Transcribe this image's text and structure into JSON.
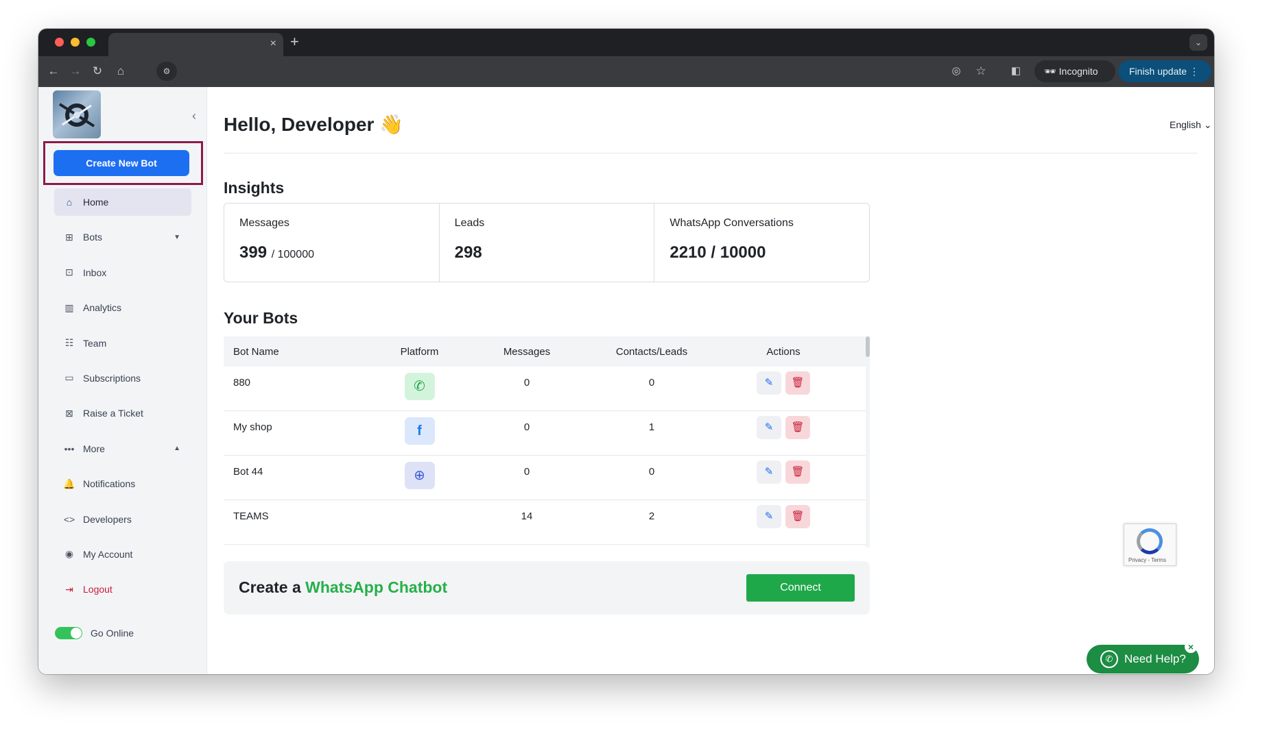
{
  "browser": {
    "incognito_label": "Incognito",
    "finish_update_label": "Finish update",
    "tab_close": "×",
    "new_tab": "+"
  },
  "header": {
    "greeting": "Hello, Developer 👋",
    "language": "English"
  },
  "sidebar": {
    "create_button": "Create New Bot",
    "items": [
      {
        "label": "Home",
        "active": true
      },
      {
        "label": "Bots",
        "caret": "down"
      },
      {
        "label": "Inbox"
      },
      {
        "label": "Analytics"
      },
      {
        "label": "Team"
      },
      {
        "label": "Subscriptions"
      },
      {
        "label": "Raise a Ticket"
      },
      {
        "label": "More",
        "caret": "up"
      },
      {
        "label": "Notifications"
      },
      {
        "label": "Developers"
      },
      {
        "label": "My Account"
      },
      {
        "label": "Logout"
      }
    ],
    "go_online_label": "Go Online",
    "go_online": true
  },
  "insights": {
    "title": "Insights",
    "cards": [
      {
        "label": "Messages",
        "value": "399",
        "sub": "/ 100000"
      },
      {
        "label": "Leads",
        "value": "298",
        "sub": ""
      },
      {
        "label": "WhatsApp Conversations",
        "value": "2210 / 10000",
        "sub": ""
      }
    ]
  },
  "bots": {
    "title": "Your Bots",
    "columns": [
      "Bot Name",
      "Platform",
      "Messages",
      "Contacts/Leads",
      "Actions"
    ],
    "rows": [
      {
        "name": "880",
        "platform": "whatsapp",
        "messages": "0",
        "leads": "0"
      },
      {
        "name": "My shop",
        "platform": "facebook",
        "messages": "0",
        "leads": "1"
      },
      {
        "name": "Bot 44",
        "platform": "web",
        "messages": "0",
        "leads": "0"
      },
      {
        "name": "TEAMS",
        "platform": "",
        "messages": "14",
        "leads": "2"
      }
    ]
  },
  "cta": {
    "prefix": "Create a",
    "highlight": "WhatsApp Chatbot",
    "button": "Connect"
  },
  "recaptcha": {
    "links": "Privacy - Terms"
  },
  "help": {
    "label": "Need Help?"
  },
  "colors": {
    "primary": "#1d6ff2",
    "whatsapp_green": "#25b04a",
    "danger": "#c81e3a"
  }
}
